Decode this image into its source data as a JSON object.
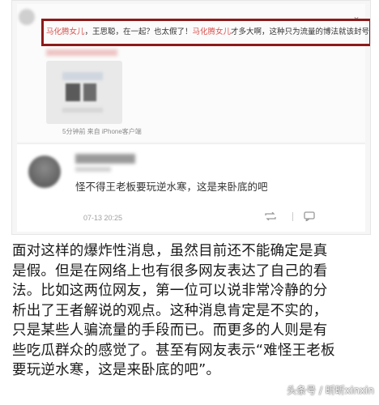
{
  "post": {
    "quote_tag1": "马化腾女儿",
    "quote_mid1": "，王思聪，在一起？也太假了！",
    "quote_tag2": "马化腾女儿",
    "quote_mid2": "才多大啊，这种只为流量的博法就该封号。",
    "meta": "5分钟前 来自 iPhone客户端"
  },
  "comment": {
    "text": "怪不得王老板要玩逆水寒，这是来卧底的吧",
    "time": "07-13 20:25"
  },
  "article": {
    "lines": [
      "面对这样的爆炸性消息，虽然目前还不能确定是真",
      "是假。但是在网络上也有很多网友表达了自己的看",
      "法。比如这两位网友，第一位可以说非常冷静的分",
      "析出了王者解说的观点。这种消息肯定是不实的，",
      "只是某些人骗流量的手段而已。而更多的人则是有",
      "些吃瓜群众的感觉了。甚至有网友表示“难怪王老板",
      "要玩逆水寒，这是来卧底的吧”。"
    ]
  },
  "watermark": "头条号 / 昕昕xinxin",
  "icons": {
    "repost": "repost-icon",
    "comment": "comment-icon",
    "menu": "chevron-down-icon"
  },
  "colors": {
    "highlight_border": "#8c1a1a",
    "tag_red": "#d9534f"
  }
}
